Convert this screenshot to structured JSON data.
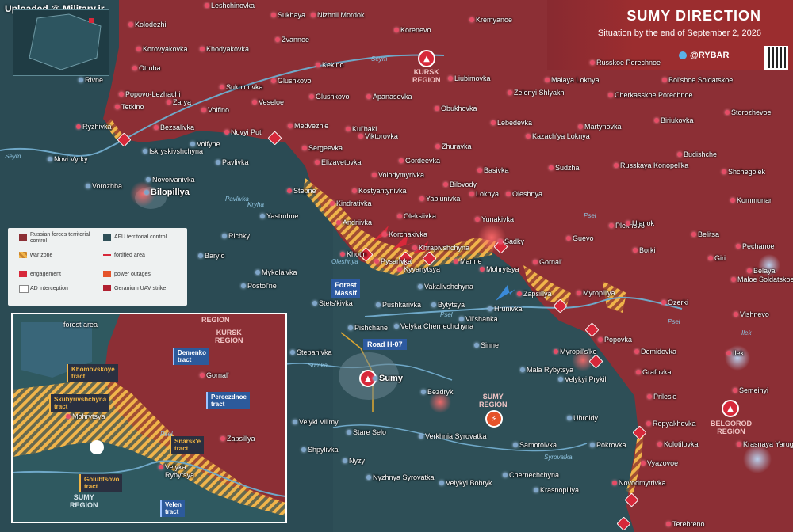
{
  "watermark": "Uploaded @ Military.ir",
  "header": {
    "title": "SUMY DIRECTION",
    "subtitle": "Situation by the end of September 2, 2026",
    "brand": "@RYBAR"
  },
  "colors": {
    "russian_territory": "#8c2f35",
    "afu_territory": "#2d4f56",
    "war_zone": "#e7a83b",
    "engagement": "#d7283a",
    "river": "#6fa8c8"
  },
  "regions": {
    "kursk": "KURSK\nREGION",
    "sumy": "SUMY\nREGION",
    "belgorod": "BELGOROD\nREGION"
  },
  "legend": {
    "russian_forces": "Russian forces territorial control",
    "afu_control": "AFU territorial control",
    "war_zone": "war zone",
    "fortified": "fortified area",
    "engagement": "engagement",
    "power_outages": "power outages",
    "ad_interception": "AD interception",
    "geranium_strike": "Geranium UAV strike"
  },
  "map_labels": {
    "forest_massif": "Forest\nMassif",
    "road": "Road H-07"
  },
  "towns_ru": [
    "Leshchinovka",
    "Sukhaya",
    "Nizhnii Mordok",
    "Korenevo",
    "Kremyanoe",
    "Kolodezhi",
    "Zvannoe",
    "Korovyakovka",
    "Khodyakovka",
    "Kekino",
    "Otruba",
    "Glushkovo",
    "Popovo-Lezhachi",
    "Sukhinovka",
    "Tetkino",
    "Zarya",
    "Volfino",
    "Veseloe",
    "Glushkovo",
    "Apanasovka",
    "Liubimovka",
    "Malaya Loknya",
    "Zelenyi Shlyakh",
    "Obukhovka",
    "Russkoe Porechnoe",
    "Bol'shoe Soldatskoe",
    "Cherkasskoe Porechnoe",
    "Storozhevoe",
    "Ryzhivka",
    "Bezsalivka",
    "Medvezh'e",
    "Kul'baki",
    "Lebedevka",
    "Martynovka",
    "Biriukovka",
    "Novyi Put'",
    "Sergeevka",
    "Viktorovka",
    "Zhuravka",
    "Kazach'ya Loknya",
    "Elizavetovka",
    "Gordeevka",
    "Volodymyrivka",
    "Basivka",
    "Sudzha",
    "Russkaya Konopel'ka",
    "Budishche",
    "Shchegolek",
    "Bilovody",
    "Yablunivka",
    "Loknya",
    "Oleshnya",
    "Kommunar",
    "Kostyantynivka",
    "Stepne",
    "Kindrativka",
    "Oleksiivka",
    "Yunakivka",
    "Plekhovo",
    "Ulanok",
    "Andriivka",
    "Korchakivka",
    "Sadky",
    "Guevo",
    "Belitsa",
    "Khrapivshchyna",
    "Borki",
    "Giri",
    "Pechanoe",
    "Khotin",
    "Pysarivka",
    "Kyyanytsya",
    "Marine",
    "Mohrytsya",
    "Gornal'",
    "Belaya",
    "Maloe Soldatskoe",
    "Ozerki",
    "Vishnevo",
    "Zapsillya",
    "Myropillya",
    "Popovka",
    "Demidovka",
    "Grafovka",
    "Myropil's'ke",
    "Prilesʹe",
    "Semeinyi",
    "Repyakhovka",
    "Kolotilovka",
    "Krasnaya Yaruga",
    "Vyazovoe",
    "Novodmytrivka",
    "Terebreno",
    "Ilek"
  ],
  "towns_ua": [
    "Volfyne",
    "Iskryskivshchyna",
    "Novi Vyrky",
    "Pavlivka",
    "Vorozhba",
    "Novoivanivka",
    "Bilopillya",
    "Yastrubne",
    "Richky",
    "Barylo",
    "Mykolaivka",
    "Postol'ne",
    "Stets'kivka",
    "Pushkarivka",
    "Vakalivshchyna",
    "Bytytsya",
    "Hrunivka",
    "Pishchane",
    "Velyka Chernechchyna",
    "Vil'shanka",
    "Sinne",
    "Stepanivka",
    "Sumy",
    "Bezdryk",
    "Mala Rybytsya",
    "Velykyi Prykil",
    "Uhroidy",
    "Velyki Vil'my",
    "Stare Selo",
    "Verkhnia Syrovatka",
    "Samotoivka",
    "Pokrovka",
    "Shpylivka",
    "Nyzy",
    "Nyzhnya Syrovatka",
    "Chernechchyna",
    "Velykyi Bobryk",
    "Krasnopillya",
    "Rivne"
  ],
  "water": [
    "Seym",
    "Seym",
    "Pavlivka",
    "Kryha",
    "Psel",
    "Psel",
    "Sumka",
    "Syrovatka",
    "Oleshnya",
    "Psel",
    "Ilek"
  ],
  "inset": {
    "labels": {
      "forest_area": "forest area",
      "region_top": "REGION",
      "kursk_region": "KURSK\nREGION",
      "sumy_region": "SUMY\nREGION",
      "gornal": "Gornal'",
      "mohrytsya": "Mohrytsya",
      "zapsillya": "Zapsillya",
      "velyka_rybytsya": "Velyka\nRybytsya",
      "psel": "Psel"
    },
    "callouts": {
      "demenko": "Demenko\ntract",
      "khomovskoye": "Khomovskoye\ntract",
      "skubyrivshchyna": "Skubyrivshchyna\ntract",
      "pereezdnoe": "Pereezdnoe\ntract",
      "snarske": "Snarsk'e\ntract",
      "golubtsovo": "Golubtsovo\ntract",
      "velen": "Velen\ntract"
    }
  }
}
